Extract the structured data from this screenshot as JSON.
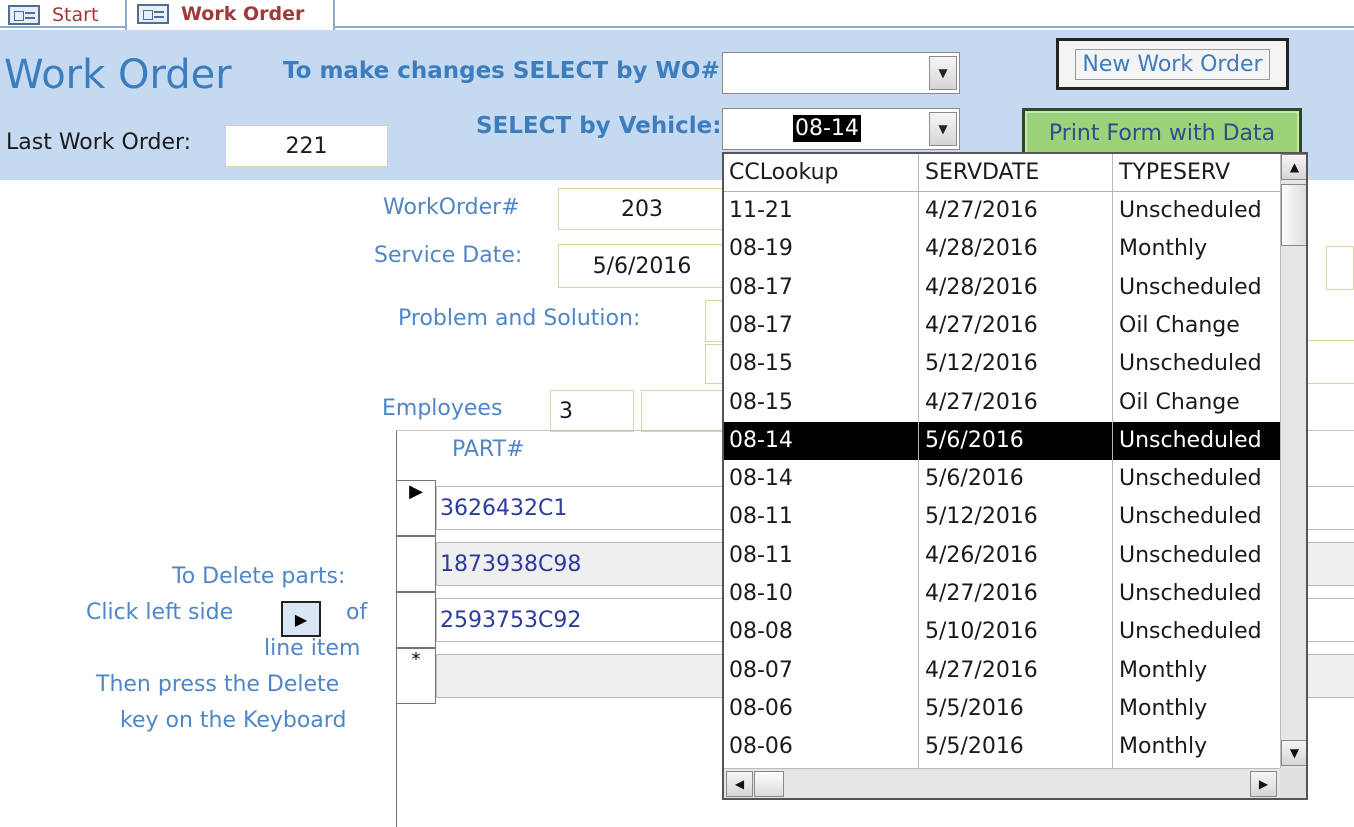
{
  "tabs": [
    {
      "label": "Start"
    },
    {
      "label": "Work Order"
    }
  ],
  "header": {
    "title": "Work Order",
    "select_wo_label": "To make changes SELECT by WO# :",
    "select_wo_value": "",
    "select_vehicle_label": "SELECT by Vehicle:",
    "select_vehicle_value": "08-14",
    "last_wo_label": "Last Work Order:",
    "last_wo_value": "221",
    "new_button": "New Work Order",
    "print_button": "Print Form with Data"
  },
  "form": {
    "workorder_label": "WorkOrder#",
    "workorder_value": "203",
    "service_date_label": "Service Date:",
    "service_date_value": "5/6/2016",
    "problem_label": "Problem and Solution:",
    "employees_label": "Employees",
    "employees_value": "3"
  },
  "parts": {
    "header": "PART#",
    "rows": [
      {
        "part": "3626432C1",
        "selector": "▶"
      },
      {
        "part": "1873938C98",
        "selector": ""
      },
      {
        "part": "2593753C92",
        "selector": ""
      },
      {
        "part": "",
        "selector": "*"
      }
    ]
  },
  "instructions": {
    "line1": "To Delete parts:",
    "line2a": "Click  left side",
    "line2b": "of",
    "line3": "line item",
    "line4": "Then press the Delete",
    "line5": "key on the Keyboard",
    "icon": "record-selector-icon"
  },
  "dropdown": {
    "columns": [
      "CCLookup",
      "SERVDATE",
      "TYPESERV"
    ],
    "rows": [
      [
        "11-21",
        "4/27/2016",
        "Unscheduled"
      ],
      [
        "08-19",
        "4/28/2016",
        "Monthly"
      ],
      [
        "08-17",
        "4/28/2016",
        "Unscheduled"
      ],
      [
        "08-17",
        "4/27/2016",
        "Oil Change"
      ],
      [
        "08-15",
        "5/12/2016",
        "Unscheduled"
      ],
      [
        "08-15",
        "4/27/2016",
        "Oil Change"
      ],
      [
        "08-14",
        "5/6/2016",
        "Unscheduled"
      ],
      [
        "08-14",
        "5/6/2016",
        "Unscheduled"
      ],
      [
        "08-11",
        "5/12/2016",
        "Unscheduled"
      ],
      [
        "08-11",
        "4/26/2016",
        "Unscheduled"
      ],
      [
        "08-10",
        "4/27/2016",
        "Unscheduled"
      ],
      [
        "08-08",
        "5/10/2016",
        "Unscheduled"
      ],
      [
        "08-07",
        "4/27/2016",
        "Monthly"
      ],
      [
        "08-06",
        "5/5/2016",
        "Monthly"
      ],
      [
        "08-06",
        "5/5/2016",
        "Monthly"
      ]
    ],
    "selected_index": 6
  },
  "colors": {
    "header_band": "#c5d9f1",
    "label_blue": "#4f86c6",
    "title_blue": "#3c7dbd",
    "print_button": "#9bd27a",
    "part_text": "#2d3a9f"
  }
}
